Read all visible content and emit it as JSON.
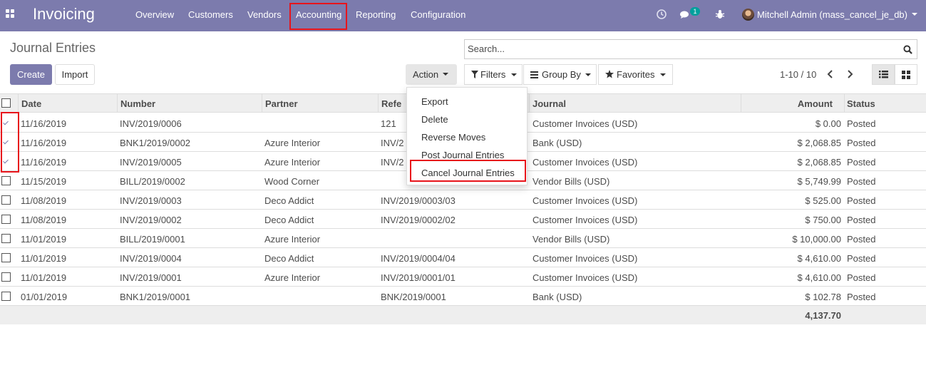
{
  "navbar": {
    "app_title": "Invoicing",
    "menu": [
      "Overview",
      "Customers",
      "Vendors",
      "Accounting",
      "Reporting",
      "Configuration"
    ],
    "chat_count": "1",
    "user_name": "Mitchell Admin (mass_cancel_je_db)",
    "icons": [
      "apps-icon",
      "clock-icon",
      "chat-icon",
      "bug-icon"
    ]
  },
  "control_panel": {
    "title": "Journal Entries",
    "search_placeholder": "Search...",
    "create_label": "Create",
    "import_label": "Import",
    "action_label": "Action",
    "filters_label": "Filters",
    "group_by_label": "Group By",
    "favorites_label": "Favorites",
    "pager": "1-10 / 10"
  },
  "action_menu": [
    "Export",
    "Delete",
    "Reverse Moves",
    "Post Journal Entries",
    "Cancel Journal Entries"
  ],
  "table": {
    "columns": [
      "Date",
      "Number",
      "Partner",
      "Refe",
      "Journal",
      "Amount",
      "Status"
    ],
    "rows": [
      {
        "checked": true,
        "date": "11/16/2019",
        "number": "INV/2019/0006",
        "partner": "",
        "reference": "121",
        "journal": "Customer Invoices (USD)",
        "amount": "$ 0.00",
        "status": "Posted"
      },
      {
        "checked": true,
        "date": "11/16/2019",
        "number": "BNK1/2019/0002",
        "partner": "Azure Interior",
        "reference": "INV/2",
        "journal": "Bank (USD)",
        "amount": "$ 2,068.85",
        "status": "Posted"
      },
      {
        "checked": true,
        "date": "11/16/2019",
        "number": "INV/2019/0005",
        "partner": "Azure Interior",
        "reference": "INV/2",
        "journal": "Customer Invoices (USD)",
        "amount": "$ 2,068.85",
        "status": "Posted"
      },
      {
        "checked": false,
        "date": "11/15/2019",
        "number": "BILL/2019/0002",
        "partner": "Wood Corner",
        "reference": "",
        "journal": "Vendor Bills (USD)",
        "amount": "$ 5,749.99",
        "status": "Posted"
      },
      {
        "checked": false,
        "date": "11/08/2019",
        "number": "INV/2019/0003",
        "partner": "Deco Addict",
        "reference": "INV/2019/0003/03",
        "journal": "Customer Invoices (USD)",
        "amount": "$ 525.00",
        "status": "Posted"
      },
      {
        "checked": false,
        "date": "11/08/2019",
        "number": "INV/2019/0002",
        "partner": "Deco Addict",
        "reference": "INV/2019/0002/02",
        "journal": "Customer Invoices (USD)",
        "amount": "$ 750.00",
        "status": "Posted"
      },
      {
        "checked": false,
        "date": "11/01/2019",
        "number": "BILL/2019/0001",
        "partner": "Azure Interior",
        "reference": "",
        "journal": "Vendor Bills (USD)",
        "amount": "$ 10,000.00",
        "status": "Posted"
      },
      {
        "checked": false,
        "date": "11/01/2019",
        "number": "INV/2019/0004",
        "partner": "Deco Addict",
        "reference": "INV/2019/0004/04",
        "journal": "Customer Invoices (USD)",
        "amount": "$ 4,610.00",
        "status": "Posted"
      },
      {
        "checked": false,
        "date": "11/01/2019",
        "number": "INV/2019/0001",
        "partner": "Azure Interior",
        "reference": "INV/2019/0001/01",
        "journal": "Customer Invoices (USD)",
        "amount": "$ 4,610.00",
        "status": "Posted"
      },
      {
        "checked": false,
        "date": "01/01/2019",
        "number": "BNK1/2019/0001",
        "partner": "",
        "reference": "BNK/2019/0001",
        "journal": "Bank (USD)",
        "amount": "$ 102.78",
        "status": "Posted"
      }
    ],
    "total_amount": "4,137.70"
  },
  "colors": {
    "brand": "#7c7bad",
    "highlight": "#e8141b"
  }
}
